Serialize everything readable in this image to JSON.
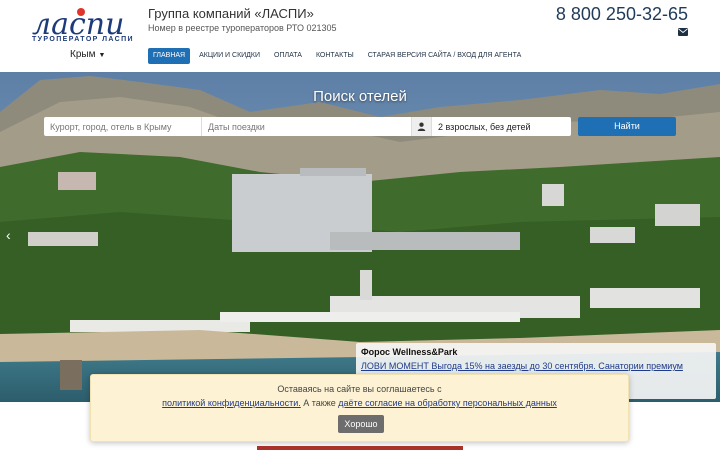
{
  "header": {
    "logo_text": "ласпи",
    "logo_tagline": "ТУРОПЕРАТОР ЛАСПИ",
    "region": "Крым",
    "company_name": "Группа компаний «ЛАСПИ»",
    "registry": "Номер в реестре туроператоров РТО 021305",
    "phone": "8 800 250-32-65"
  },
  "nav": {
    "items": [
      {
        "label": "ГЛАВНАЯ",
        "active": true
      },
      {
        "label": "АКЦИИ И СКИДКИ"
      },
      {
        "label": "ОПЛАТА"
      },
      {
        "label": "КОНТАКТЫ"
      },
      {
        "label": "СТАРАЯ ВЕРСИЯ САЙТА / ВХОД ДЛЯ АГЕНТА"
      }
    ]
  },
  "hero": {
    "title": "Поиск отелей",
    "search": {
      "location_placeholder": "Курорт, город, отель в Крыму",
      "dates_placeholder": "Даты поездки",
      "guests_value": "2 взрослых, без детей",
      "button_label": "Найти"
    },
    "promo": {
      "title": "Форос Wellness&Park",
      "text": "ЛОВИ МОМЕНТ Выгода 15% на заезды до 30 сентября. Санатории премиум класса ... первой линии моря."
    }
  },
  "cookie": {
    "line1": "Оставаясь на сайте вы соглашаетесь с",
    "privacy_link": "политикой конфиденциальности.",
    "middle": "А также",
    "consent_link": "даёте согласие на обработку персональных данных",
    "ok_label": "Хорошо"
  },
  "colors": {
    "accent": "#1f6fb5",
    "brand_red": "#e0352b",
    "brand_blue": "#1d3a7a",
    "cookie_bg": "#fdf3d4"
  }
}
